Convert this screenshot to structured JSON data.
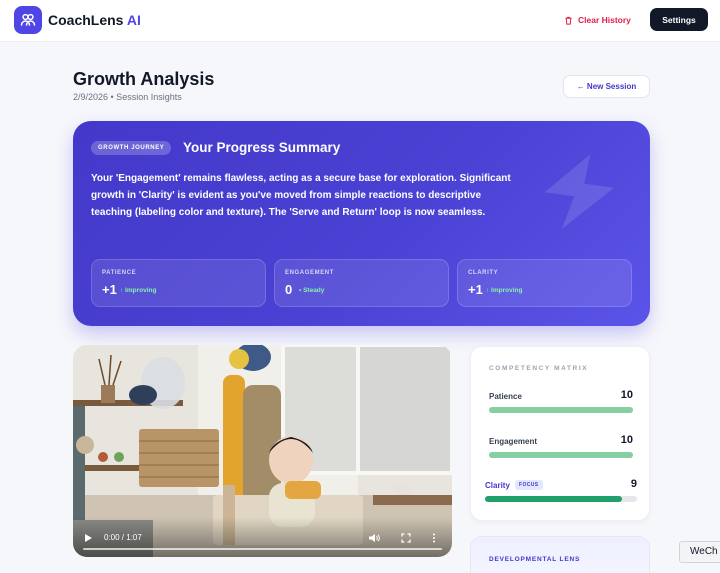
{
  "header": {
    "brand_name": "CoachLens",
    "brand_suffix": "AI",
    "brand_icon": "users-icon",
    "clear_history_label": "Clear History",
    "clear_history_icon": "trash-icon",
    "settings_label": "Settings"
  },
  "page": {
    "title": "Growth Analysis",
    "subtitle": "2/9/2026 • Session Insights",
    "new_session_label": "← New Session"
  },
  "summary": {
    "badge": "GROWTH JOURNEY",
    "title": "Your Progress Summary",
    "text": "Your 'Engagement' remains flawless, acting as a secure base for exploration. Significant growth in 'Clarity' is evident as you've moved from simple reactions to descriptive teaching (labeling color and texture). The 'Serve and Return' loop is now seamless.",
    "deco_icon": "lightning-bolt-icon",
    "metrics": [
      {
        "label": "PATIENCE",
        "value": "+1",
        "trend": "↑ Improving",
        "trend_color": "#86efac"
      },
      {
        "label": "ENGAGEMENT",
        "value": "0",
        "trend": "• Steady",
        "trend_color": "#86efac"
      },
      {
        "label": "CLARITY",
        "value": "+1",
        "trend": "↑ Improving",
        "trend_color": "#86efac"
      }
    ]
  },
  "video": {
    "time": "0:00 / 1:07",
    "progress": 0,
    "play_icon": "play-icon",
    "volume_icon": "volume-icon",
    "fullscreen_icon": "fullscreen-icon",
    "more_icon": "more-vertical-icon"
  },
  "matrix": {
    "title": "COMPETENCY MATRIX",
    "items": [
      {
        "label": "Patience",
        "value": "10",
        "fraction": 1.0
      },
      {
        "label": "Engagement",
        "value": "10",
        "fraction": 1.0
      },
      {
        "label": "Clarity",
        "value": "9",
        "fraction": 0.9,
        "badge": "FOCUS"
      }
    ],
    "bar_color": "#86cfa0",
    "focus_bar_color": "#22a06b"
  },
  "lens": {
    "title": "DEVELOPMENTAL LENS"
  },
  "tooltip": {
    "text": "WeCh"
  },
  "colors": {
    "accent": "#4f46e5",
    "danger": "#e11d48",
    "dark": "#111827"
  }
}
